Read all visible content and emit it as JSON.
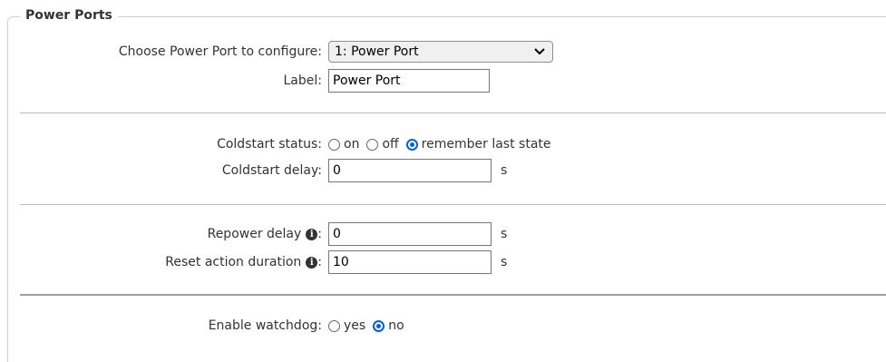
{
  "section": {
    "legend": "Power Ports"
  },
  "port_select": {
    "label": "Choose Power Port to configure:",
    "value": "1: Power Port"
  },
  "label_field": {
    "label": "Label:",
    "value": "Power Port"
  },
  "coldstart_status": {
    "label": "Coldstart status:",
    "options": [
      {
        "label": "on",
        "checked": false
      },
      {
        "label": "off",
        "checked": false
      },
      {
        "label": "remember last state",
        "checked": true
      }
    ]
  },
  "coldstart_delay": {
    "label": "Coldstart delay:",
    "value": "0",
    "unit": "s"
  },
  "repower_delay": {
    "label": "Repower delay",
    "colon": ":",
    "value": "0",
    "unit": "s"
  },
  "reset_duration": {
    "label": "Reset action duration",
    "colon": ":",
    "value": "10",
    "unit": "s"
  },
  "watchdog": {
    "label": "Enable watchdog:",
    "options": [
      {
        "label": "yes",
        "checked": false
      },
      {
        "label": "no",
        "checked": true
      }
    ]
  },
  "icons": {
    "info": "info-icon",
    "dropdown": "chevron-down-icon"
  }
}
